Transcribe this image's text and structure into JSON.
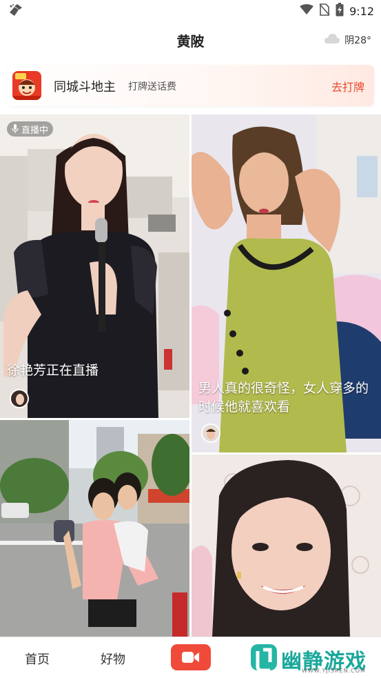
{
  "status_bar": {
    "time": "9:12",
    "icons": [
      "cleaner-icon",
      "wifi-icon",
      "no-sim-icon",
      "battery-icon"
    ]
  },
  "header": {
    "title": "黄陂",
    "weather": {
      "condition": "阴",
      "temperature": "28°",
      "text": "阴28°",
      "icon": "cloud-icon"
    }
  },
  "banner": {
    "title": "同城斗地主",
    "subtitle": "打牌送话费",
    "cta": "去打牌",
    "accent": "#e8492f"
  },
  "feed": {
    "cards": [
      {
        "live_badge": "直播中",
        "caption": "徐艳芳正在直播"
      },
      {
        "caption": "男人真的很奇怪，女人穿多的时候他就喜欢看"
      },
      {
        "caption": ""
      },
      {
        "caption": ""
      }
    ]
  },
  "bottom_nav": {
    "items": [
      {
        "label": "首页"
      },
      {
        "label": "好物"
      },
      {
        "label": "",
        "icon": "video-camera-icon",
        "color": "#f04a3a"
      }
    ]
  },
  "watermark": {
    "text": "幽静游戏",
    "url": "WWW.YJISREN.COM",
    "color": "#1aa89b"
  }
}
